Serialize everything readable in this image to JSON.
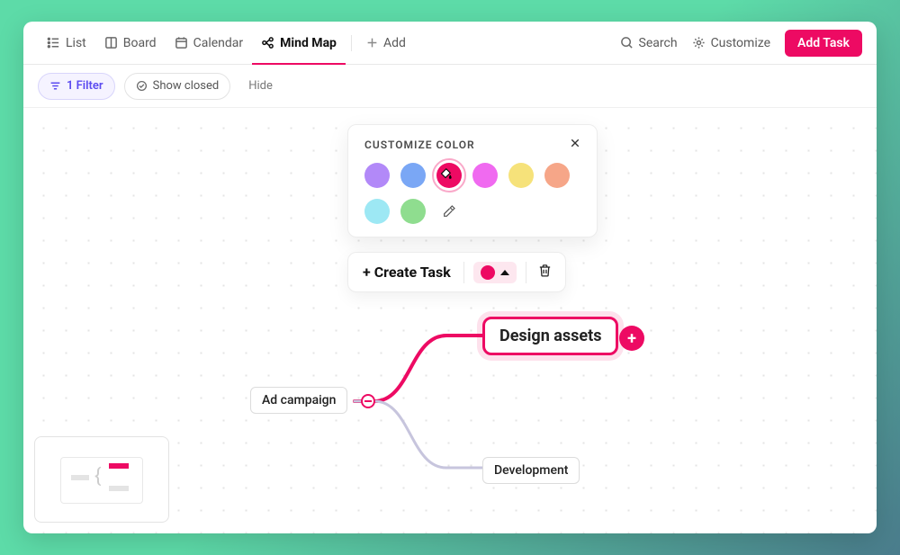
{
  "tabs": {
    "list": "List",
    "board": "Board",
    "calendar": "Calendar",
    "mindmap": "Mind Map",
    "add": "Add"
  },
  "topActions": {
    "search": "Search",
    "customize": "Customize",
    "addTask": "Add Task"
  },
  "filters": {
    "filter": "1 Filter",
    "showClosed": "Show closed",
    "hide": "Hide"
  },
  "colorPopover": {
    "title": "CUSTOMIZE COLOR",
    "swatches": [
      {
        "name": "purple",
        "hex": "#b289f8"
      },
      {
        "name": "blue",
        "hex": "#7aa7f5"
      },
      {
        "name": "pink",
        "hex": "#ed0a63",
        "selected": true
      },
      {
        "name": "magenta",
        "hex": "#f06af0"
      },
      {
        "name": "yellow",
        "hex": "#f6e27a"
      },
      {
        "name": "orange",
        "hex": "#f6a688"
      },
      {
        "name": "cyan",
        "hex": "#9de8f4"
      },
      {
        "name": "green",
        "hex": "#8fdd8f"
      }
    ]
  },
  "taskToolbar": {
    "create": "+ Create Task"
  },
  "nodes": {
    "root": "Ad campaign",
    "designAssets": "Design assets",
    "development": "Development"
  }
}
